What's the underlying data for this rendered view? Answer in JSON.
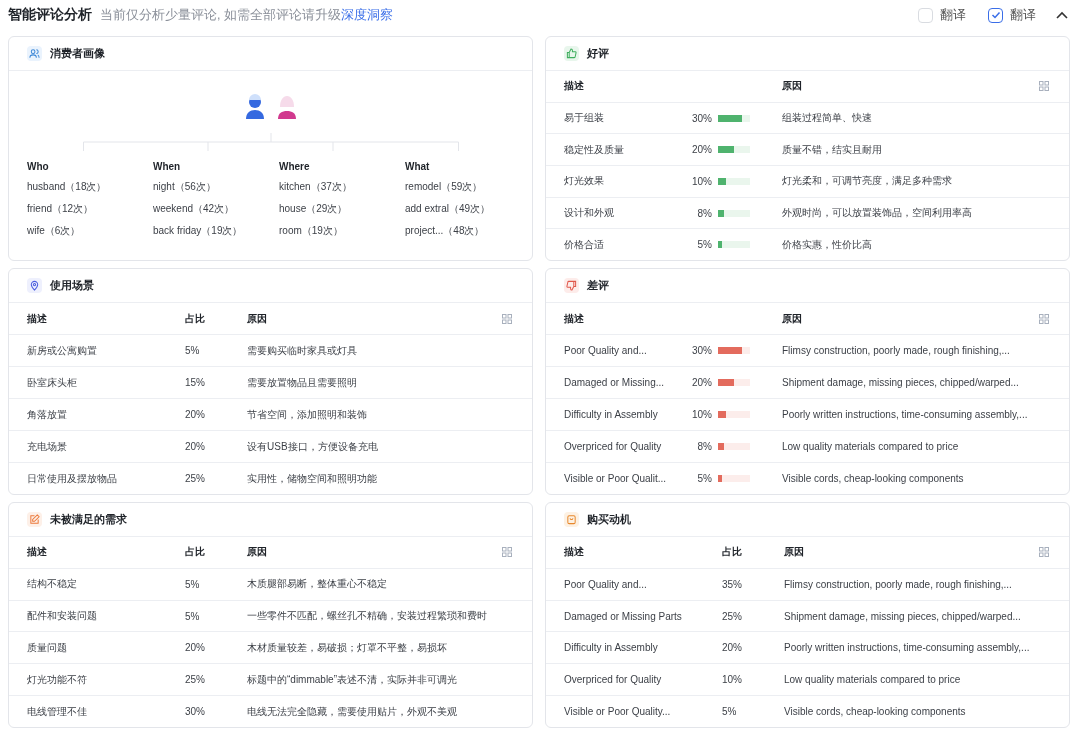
{
  "header": {
    "title": "智能评论分析",
    "note": "当前仅分析少量评论, 如需全部评论请升级",
    "link": "深度洞察",
    "toggles": [
      {
        "label": "翻译",
        "checked": false
      },
      {
        "label": "翻译",
        "checked": true
      }
    ],
    "expanded": true
  },
  "panels": [
    {
      "kind": "portrait",
      "title": "消费者画像",
      "groups": [
        {
          "heading": "Who",
          "items": [
            "husband（18次）",
            "friend（12次）",
            "wife（6次）"
          ]
        },
        {
          "heading": "When",
          "items": [
            "night（56次）",
            "weekend（42次）",
            "back friday（19次）"
          ]
        },
        {
          "heading": "Where",
          "items": [
            "kitchen（37次）",
            "house（29次）",
            "room（19次）"
          ]
        },
        {
          "heading": "What",
          "items": [
            "remodel（59次）",
            "add extral（49次）",
            "project...（48次）"
          ]
        }
      ]
    },
    {
      "kind": "bar_table",
      "title": "好评",
      "color": "#4fb36e",
      "columns": [
        "描述",
        "原因"
      ],
      "rows": [
        {
          "desc": "易于组装",
          "share": "30%",
          "level": 0.75,
          "reason": "组装过程简单、快速"
        },
        {
          "desc": "稳定性及质量",
          "share": "20%",
          "level": 0.5,
          "reason": "质量不错，结实且耐用"
        },
        {
          "desc": "灯光效果",
          "share": "10%",
          "level": 0.25,
          "reason": "灯光柔和，可调节亮度，满足多种需求"
        },
        {
          "desc": "设计和外观",
          "share": "8%",
          "level": 0.2,
          "reason": "外观时尚，可以放置装饰品，空间利用率高"
        },
        {
          "desc": "价格合适",
          "share": "5%",
          "level": 0.12,
          "reason": "价格实惠，性价比高"
        }
      ]
    },
    {
      "kind": "table",
      "title": "使用场景",
      "columns": [
        "描述",
        "占比",
        "原因"
      ],
      "rows": [
        {
          "desc": "新房或公寓购置",
          "share": "5%",
          "reason": "需要购买临时家具或灯具"
        },
        {
          "desc": "卧室床头柜",
          "share": "15%",
          "reason": "需要放置物品且需要照明"
        },
        {
          "desc": "角落放置",
          "share": "20%",
          "reason": "节省空间，添加照明和装饰"
        },
        {
          "desc": "充电场景",
          "share": "20%",
          "reason": "设有USB接口，方便设备充电"
        },
        {
          "desc": "日常使用及摆放物品",
          "share": "25%",
          "reason": "实用性，储物空间和照明功能"
        }
      ]
    },
    {
      "kind": "bar_table",
      "title": "差评",
      "color": "#e36b5d",
      "columns": [
        "描述",
        "原因"
      ],
      "rows": [
        {
          "desc": "Poor Quality and...",
          "share": "30%",
          "level": 0.75,
          "reason": "Flimsy construction, poorly made, rough finishing,..."
        },
        {
          "desc": "Damaged or Missing...",
          "share": "20%",
          "level": 0.5,
          "reason": "Shipment damage, missing pieces, chipped/warped..."
        },
        {
          "desc": "Difficulty in Assembly",
          "share": "10%",
          "level": 0.25,
          "reason": "Poorly written instructions, time-consuming assembly,..."
        },
        {
          "desc": "Overpriced for Quality",
          "share": "8%",
          "level": 0.2,
          "reason": "Low quality materials compared to price"
        },
        {
          "desc": "Visible or Poor Qualit...",
          "share": "5%",
          "level": 0.12,
          "reason": "Visible cords, cheap-looking components"
        }
      ]
    },
    {
      "kind": "table",
      "title": "未被满足的需求",
      "columns": [
        "描述",
        "占比",
        "原因"
      ],
      "rows": [
        {
          "desc": "结构不稳定",
          "share": "5%",
          "reason": "木质腿部易断，整体重心不稳定"
        },
        {
          "desc": "配件和安装问题",
          "share": "5%",
          "reason": "一些零件不匹配，螺丝孔不精确，安装过程繁琐和费时"
        },
        {
          "desc": "质量问题",
          "share": "20%",
          "reason": "木材质量较差，易破损；灯罩不平整，易损坏"
        },
        {
          "desc": "灯光功能不符",
          "share": "25%",
          "reason": "标题中的“dimmable”表述不清，实际并非可调光"
        },
        {
          "desc": "电线管理不佳",
          "share": "30%",
          "reason": "电线无法完全隐藏，需要使用贴片，外观不美观"
        }
      ]
    },
    {
      "kind": "table",
      "title": "购买动机",
      "columns": [
        "描述",
        "占比",
        "原因"
      ],
      "rows": [
        {
          "desc": "Poor Quality and...",
          "share": "35%",
          "reason": "Flimsy construction, poorly made, rough finishing,..."
        },
        {
          "desc": "Damaged or Missing Parts",
          "share": "25%",
          "reason": "Shipment damage, missing pieces, chipped/warped..."
        },
        {
          "desc": "Difficulty in Assembly",
          "share": "20%",
          "reason": "Poorly written instructions, time-consuming assembly,..."
        },
        {
          "desc": "Overpriced for Quality",
          "share": "10%",
          "reason": "Low quality materials compared to price"
        },
        {
          "desc": "Visible or Poor Quality...",
          "share": "5%",
          "reason": "Visible cords, cheap-looking components"
        }
      ]
    }
  ]
}
